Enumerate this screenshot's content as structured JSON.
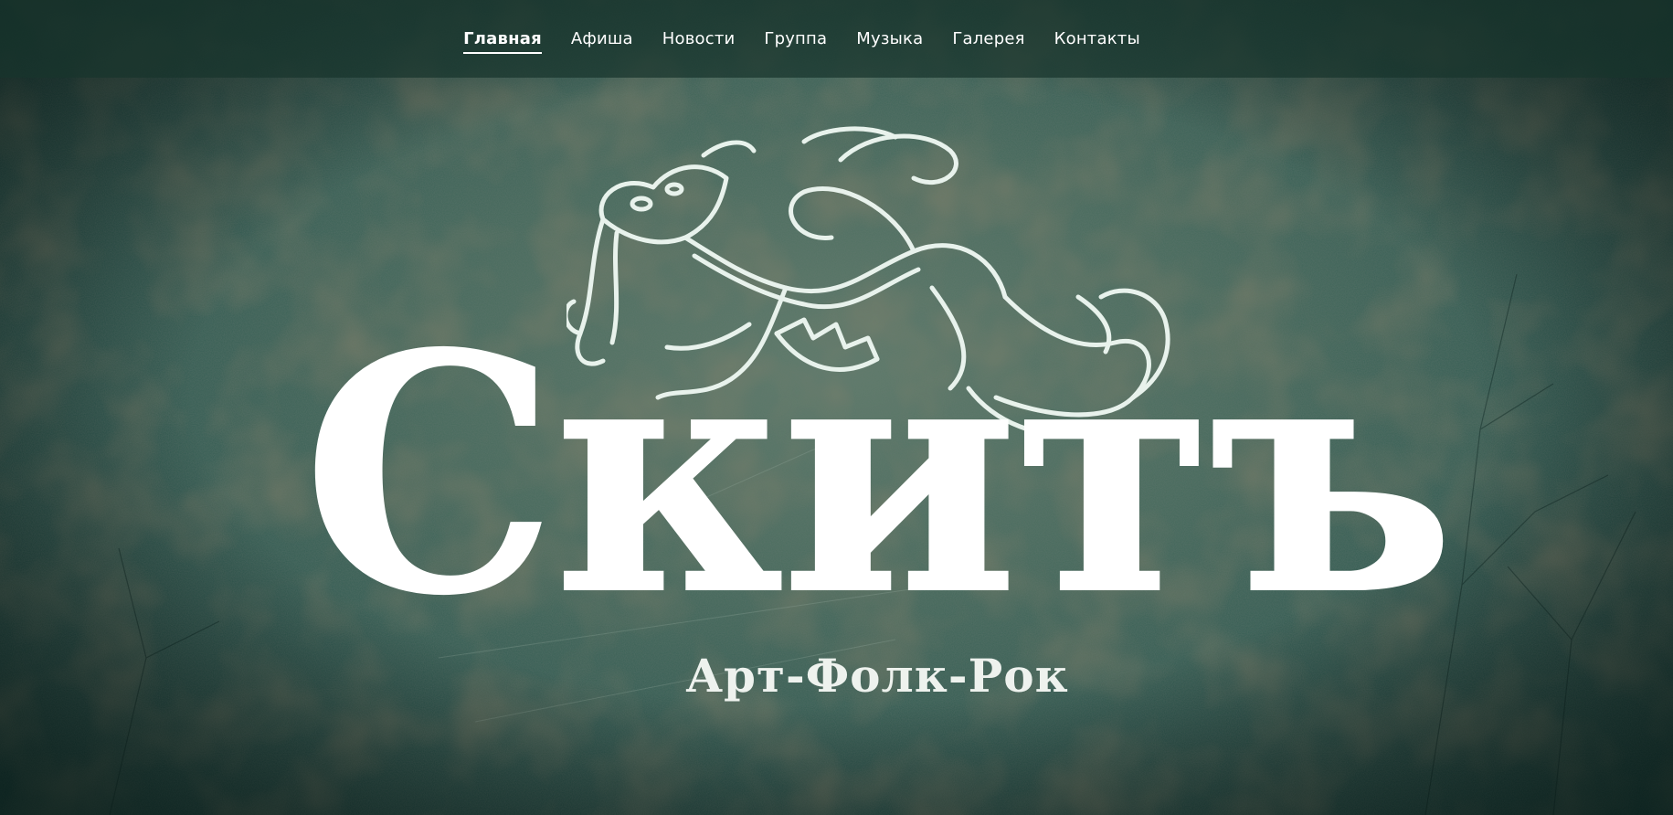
{
  "nav": {
    "items": [
      {
        "label": "Главная",
        "active": true
      },
      {
        "label": "Афиша",
        "active": false
      },
      {
        "label": "Новости",
        "active": false
      },
      {
        "label": "Группа",
        "active": false
      },
      {
        "label": "Музыка",
        "active": false
      },
      {
        "label": "Галерея",
        "active": false
      },
      {
        "label": "Контакты",
        "active": false
      }
    ]
  },
  "hero": {
    "logo_text": "Скитъ",
    "tagline": "Арт-Фолк-Рок",
    "emblem_icon": "dragon-emblem-icon"
  },
  "colors": {
    "nav_background": "#18342c",
    "text": "#ffffff",
    "background_center": "#5f7b6a",
    "background_edge": "#183b36"
  }
}
